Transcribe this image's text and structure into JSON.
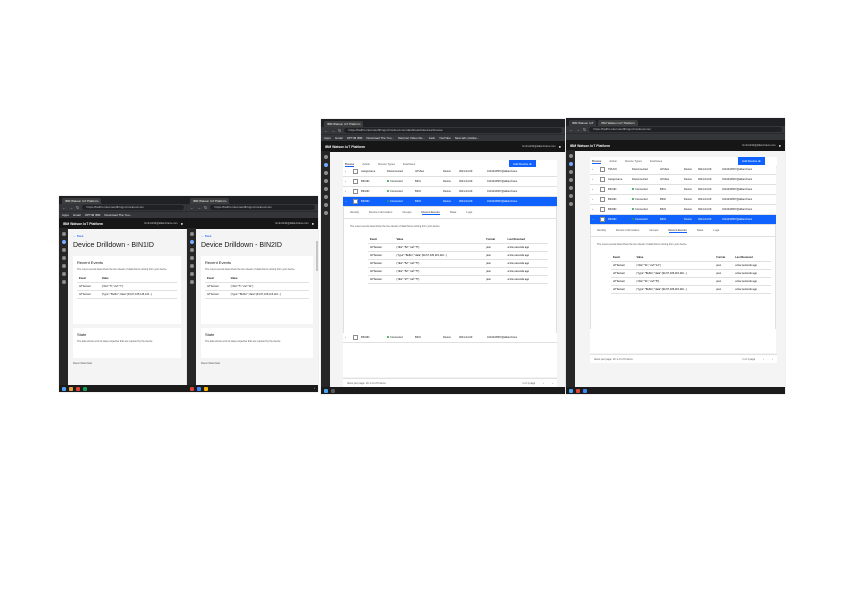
{
  "screens": {
    "bin1": {
      "tabs": [
        "IBM Watson IoT Platform"
      ],
      "url": "https://baiflm.internetofthings.ibmcloud.com",
      "bookmarks": [
        "Apps",
        "Gmail",
        "OPTIM IBM",
        "Download The Yoo..."
      ],
      "header_title": "IBM Watson IoT Platform",
      "header_user": "hmiln1234@allianztrans.com",
      "back": "Back",
      "page_title": "Device Drilldown - BIN1ID",
      "recent_events": {
        "title": "Recent Events",
        "desc": "The recent events listed show the live stream of data that is coming from your device.",
        "headers": [
          "Event",
          "Value"
        ],
        "rows": [
          [
            "IoTSensor",
            "{\"dist\":\"5\",\"val\":\"7\"}"
          ],
          [
            "IoTSensor",
            "{\"type\":\"Buffer\",\"data\":[34,67,105,115,116...]"
          ]
        ]
      },
      "state": {
        "title": "State",
        "desc": "The data shows a list of state properties that are reported by the device."
      },
      "footer": "Recent Raw Data"
    },
    "bin2": {
      "tabs": [
        "IBM Watson IoT Platform"
      ],
      "url": "https://baiflm.internetofthings.ibmcloud.com",
      "header_title": "",
      "header_user": "hmiln1234@allianztrans.com",
      "back": "Back",
      "page_title": "Device Drilldown - BIN2ID",
      "recent_events": {
        "title": "Recent Events",
        "desc": "The recent events listed show the live stream of data that is coming from your device.",
        "headers": [
          "Event",
          "Value"
        ],
        "rows": [
          [
            "IoTSensor",
            "{\"dist\":\"5\",\"val\":\"11\"}"
          ],
          [
            "IoTSensor",
            "{\"type\":\"Buffer\",\"data\":[34,67,105,115,116...]"
          ]
        ]
      },
      "state": {
        "title": "State",
        "desc": "The data shows a list of state properties that are reported by the device."
      },
      "footer": "Recent Raw Data"
    },
    "list1": {
      "tabs": [
        "IBM Watson IoT Platform"
      ],
      "url": "https://baiflm.internetofthings.ibmcloud.com/dashboard/devices/browse",
      "bookmarks": [
        "Apps",
        "Gmail",
        "OPTIM IBM",
        "Download The Yoo...",
        "Sanrinet Video Ru...",
        "Jack",
        "YouTube",
        "New tab | Adobe..."
      ],
      "header_title": "IBM Watson IoT Platform",
      "header_user": "hmiln1234@allianztrans.com",
      "subtabs": [
        "Browse",
        "Action",
        "Device Types",
        "Interfaces"
      ],
      "add_button": "Add Device",
      "rows": [
        [
          "Assignname",
          "Disconnected",
          "IoTsSec",
          "Device",
          "0021-04-09",
          "0101234567@allianztrans"
        ],
        [
          "BIN1ID",
          "Connected",
          "BIN1",
          "Device",
          "0021-04-09",
          "0101234567@allianztrans"
        ],
        [
          "BIN2ID",
          "Connected",
          "BIN4",
          "Device",
          "0021-04-09",
          "0101234567@allianztrans"
        ]
      ],
      "selected_row": [
        "BIN3ID",
        "Connected",
        "BIN3",
        "Device",
        "0021-04-09",
        "0101234567@allianztrans"
      ],
      "last_row": [
        "BIN4ID",
        "Connected",
        "BIN4",
        "Device",
        "0021-04-09",
        "0101234567@allianztrans"
      ],
      "detail_tabs": [
        "Identity",
        "Device Information",
        "Groups",
        "Recent Events",
        "State",
        "Logs"
      ],
      "detail_active": 3,
      "events_desc": "The recent events listed show the live stream of data that is coming from your device.",
      "event_headers": [
        "Event",
        "Value",
        "Format",
        "Last Received"
      ],
      "events": [
        [
          "IoTSensor",
          "{\"dist\":\"52\",\"val\":\"5\"}",
          "json",
          "a few seconds ago"
        ],
        [
          "IoTSensor",
          "{\"type\":\"Buffer\",\"data\":[34,67,105,115,116...]",
          "json",
          "a few seconds ago"
        ],
        [
          "IoTSensor",
          "{\"dist\":\"52\",\"val\":\"5\"}",
          "json",
          "a few seconds ago"
        ],
        [
          "IoTSensor",
          "{\"dist\":\"52\",\"val\":\"5\"}",
          "json",
          "a few seconds ago"
        ],
        [
          "IoTSensor",
          "{\"dist\":\"27\",\"val\":\"5\"}",
          "json",
          "a few seconds ago"
        ]
      ],
      "pager_left": "Items per page: 10  1–6 of 6 items",
      "pager_right": "1 of 1 page"
    },
    "list2": {
      "tabs": [
        "IBM Watson IoT",
        "IBM Watson IoT Platform"
      ],
      "url": "https://baiflm.internetofthings.ibmcloud.com",
      "header_title": "IBM Watson IoT Platform",
      "header_user": "hmiln1234@allianztrans.com",
      "subtabs": [
        "Browse",
        "Action",
        "Device Types",
        "Interfaces"
      ],
      "add_button": "Add Device",
      "rows": [
        [
          "TRUCK",
          "Disconnected",
          "IoTsSec",
          "Device",
          "0021-04-09",
          "0101234567@allianztrans"
        ],
        [
          "Assignname",
          "Disconnected",
          "IoTsSec",
          "Device",
          "0021-04-09",
          "0101234567@allianztrans"
        ],
        [
          "BIN1ID",
          "Connected",
          "BIN1",
          "Device",
          "0021-04-09",
          "0101234567@allianztrans"
        ],
        [
          "BIN2ID",
          "Connected",
          "BIN2",
          "Device",
          "0021-04-09",
          "0101234567@allianztrans"
        ],
        [
          "BIN3ID",
          "Connected",
          "BIN3",
          "Device",
          "0021-04-09",
          "0101234567@allianztrans"
        ]
      ],
      "selected_row": [
        "BIN4ID",
        "Connected",
        "BIN4",
        "Device",
        "0021-04-09",
        "0101234567@allianztrans"
      ],
      "detail_tabs": [
        "Identity",
        "Device Information",
        "Groups",
        "Recent Events",
        "State",
        "Logs"
      ],
      "detail_active": 3,
      "events_desc": "The recent events listed show the live stream of data that is coming from your device.",
      "event_headers": [
        "Event",
        "Value",
        "Format",
        "Last Received"
      ],
      "events": [
        [
          "IoTSensor",
          "{\"dist\":\"11\",\"val\":\"12\"}",
          "json",
          "a few seconds ago"
        ],
        [
          "IoTSensor",
          "{\"type\":\"Buffer\",\"data\":[34,67,105,115,116...]",
          "json",
          "a few seconds ago"
        ],
        [
          "IoTSensor",
          "{\"dist\":\"11\",\"val\":\"8\"}",
          "json",
          "a few seconds ago"
        ],
        [
          "IoTSensor",
          "{\"type\":\"Buffer\",\"data\":[34,67,105,115,116...]",
          "json",
          "a few seconds ago"
        ]
      ],
      "pager_left": "Items per page: 10  1–6 of 6 items",
      "pager_right": "1 of 1 page"
    }
  }
}
